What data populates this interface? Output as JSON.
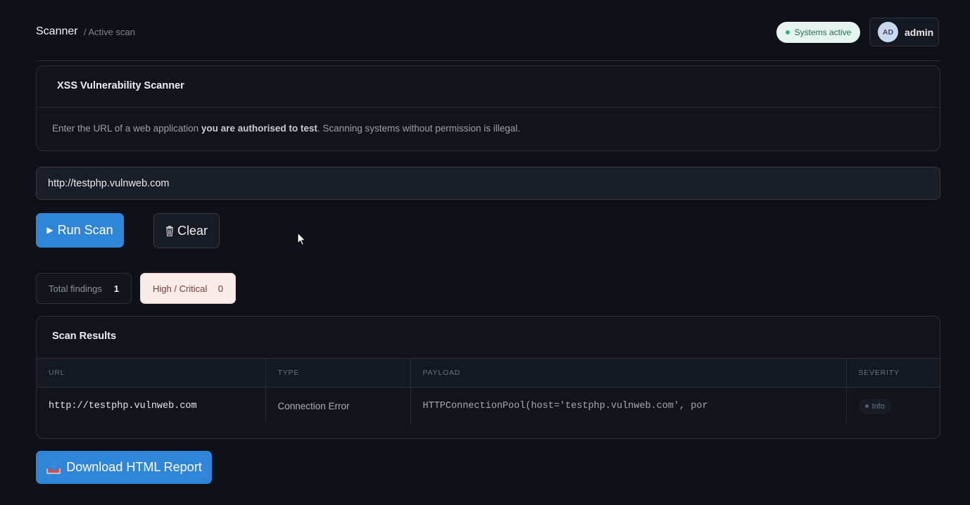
{
  "header": {
    "brand": "Scanner",
    "breadcrumb": "/ Active scan",
    "status": "Systems active",
    "user": {
      "initials": "AD",
      "name": "admin"
    }
  },
  "intro": {
    "title": "XSS Vulnerability Scanner",
    "text_before": "Enter the URL of a web application ",
    "text_bold": "you are authorised to test",
    "text_after": ". Scanning systems without permission is illegal."
  },
  "url_input": {
    "value": "http://testphp.vulnweb.com"
  },
  "buttons": {
    "run_scan": "Run Scan",
    "clear": "Clear",
    "download": "Download HTML Report"
  },
  "stats": {
    "total_label": "Total findings",
    "total_value": "1",
    "high_label": "High / Critical",
    "high_value": "0"
  },
  "results": {
    "title": "Scan Results",
    "columns": [
      "URL",
      "TYPE",
      "PAYLOAD",
      "SEVERITY"
    ],
    "rows": [
      {
        "url": "http://testphp.vulnweb.com",
        "type": "Connection Error",
        "payload": "HTTPConnectionPool(host='testphp.vulnweb.com', por",
        "severity": "Info"
      }
    ]
  },
  "colors": {
    "accent": "#2f86d9",
    "status_bg": "#e7f5f0",
    "status_dot": "#2fb380",
    "high_bg": "#fbecec"
  },
  "icons": {
    "run": "play-icon",
    "clear": "trash-icon",
    "download": "download-tray-icon",
    "cursor": "mouse-pointer-icon"
  }
}
